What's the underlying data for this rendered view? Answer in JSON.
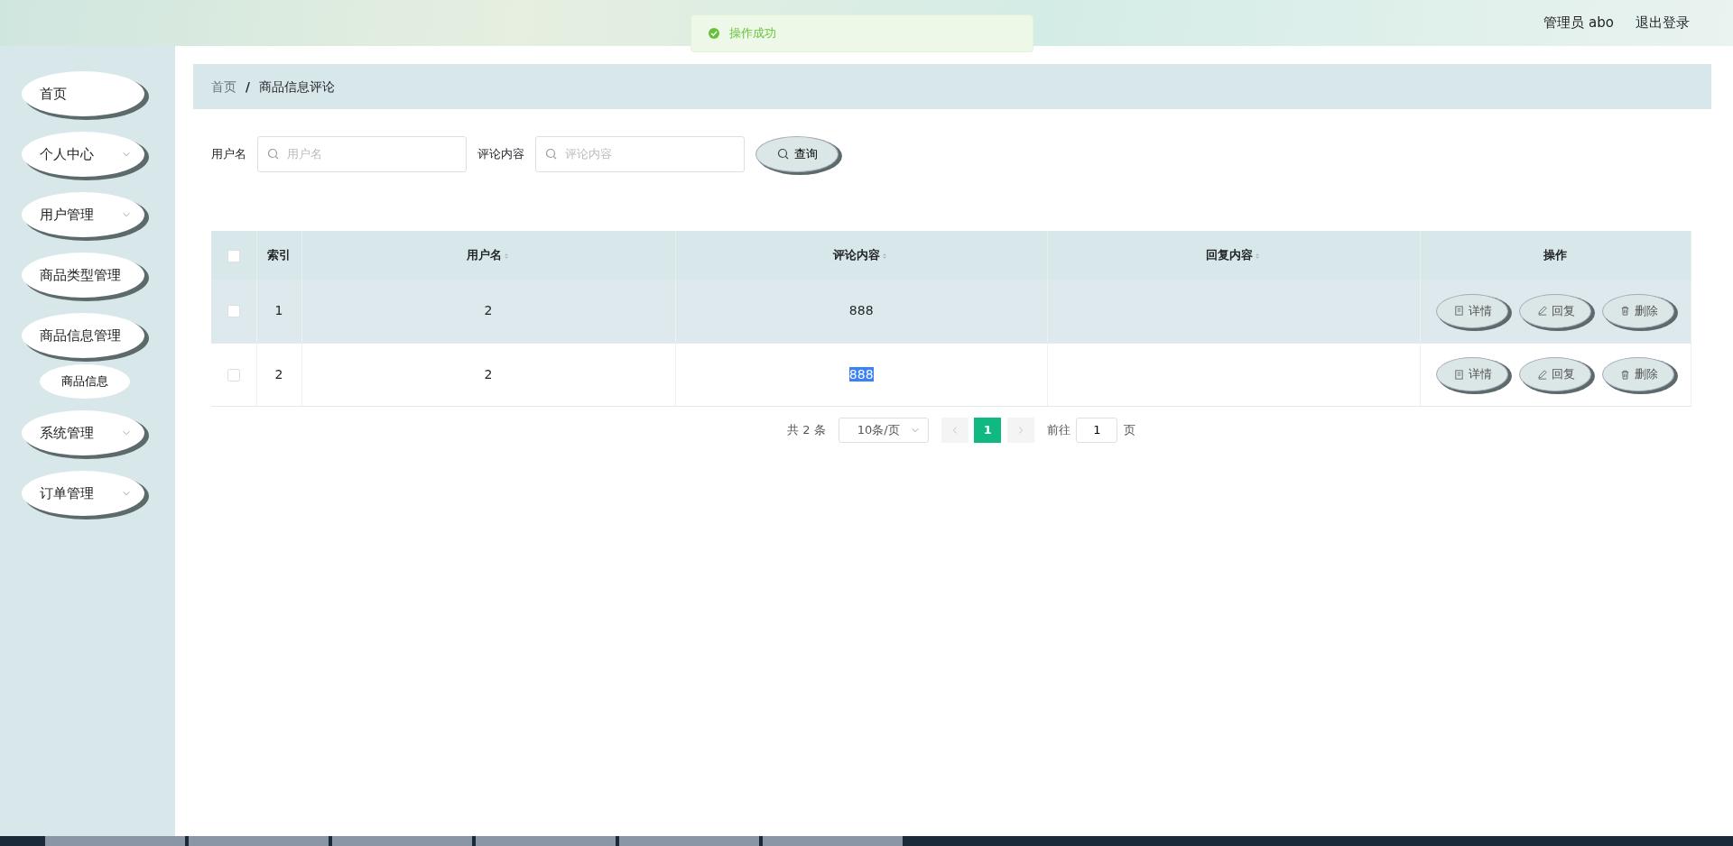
{
  "header": {
    "user": "管理员 abo",
    "logout": "退出登录"
  },
  "toast": {
    "message": "操作成功"
  },
  "sidebar": {
    "items": [
      {
        "label": "首页",
        "expandable": false
      },
      {
        "label": "个人中心",
        "expandable": true
      },
      {
        "label": "用户管理",
        "expandable": true
      },
      {
        "label": "商品类型管理",
        "expandable": false
      },
      {
        "label": "商品信息管理",
        "expandable": false,
        "children": [
          {
            "label": "商品信息"
          }
        ]
      },
      {
        "label": "系统管理",
        "expandable": true
      },
      {
        "label": "订单管理",
        "expandable": true
      }
    ]
  },
  "breadcrumb": {
    "separator": "/",
    "items": [
      "首页",
      "商品信息评论"
    ]
  },
  "search": {
    "fields": [
      {
        "label": "用户名",
        "placeholder": "用户名"
      },
      {
        "label": "评论内容",
        "placeholder": "评论内容"
      }
    ],
    "button": "查询"
  },
  "table": {
    "select_all_checked": false,
    "columns": [
      {
        "label": "索引",
        "sortable": false
      },
      {
        "label": "用户名",
        "sortable": true
      },
      {
        "label": "评论内容",
        "sortable": true
      },
      {
        "label": "回复内容",
        "sortable": true
      },
      {
        "label": "操作",
        "sortable": false
      }
    ],
    "rows": [
      {
        "checked": false,
        "hovered": true,
        "cells": [
          "1",
          "2",
          "888",
          ""
        ],
        "comment_highlighted": false,
        "actions": [
          {
            "kind": "detail",
            "label": "详情"
          },
          {
            "kind": "reply",
            "label": "回复"
          },
          {
            "kind": "delete",
            "label": "删除"
          }
        ]
      },
      {
        "checked": false,
        "hovered": false,
        "cells": [
          "2",
          "2",
          "888",
          ""
        ],
        "comment_highlighted": true,
        "actions": [
          {
            "kind": "detail",
            "label": "详情"
          },
          {
            "kind": "reply",
            "label": "回复"
          },
          {
            "kind": "delete",
            "label": "删除"
          }
        ]
      }
    ]
  },
  "pagination": {
    "total": "共 2 条",
    "page_size": "10条/页",
    "pages": [
      {
        "label": "1",
        "selected": true
      }
    ],
    "goto_label": "前往",
    "goto_value": "1",
    "goto_suffix": "页"
  }
}
